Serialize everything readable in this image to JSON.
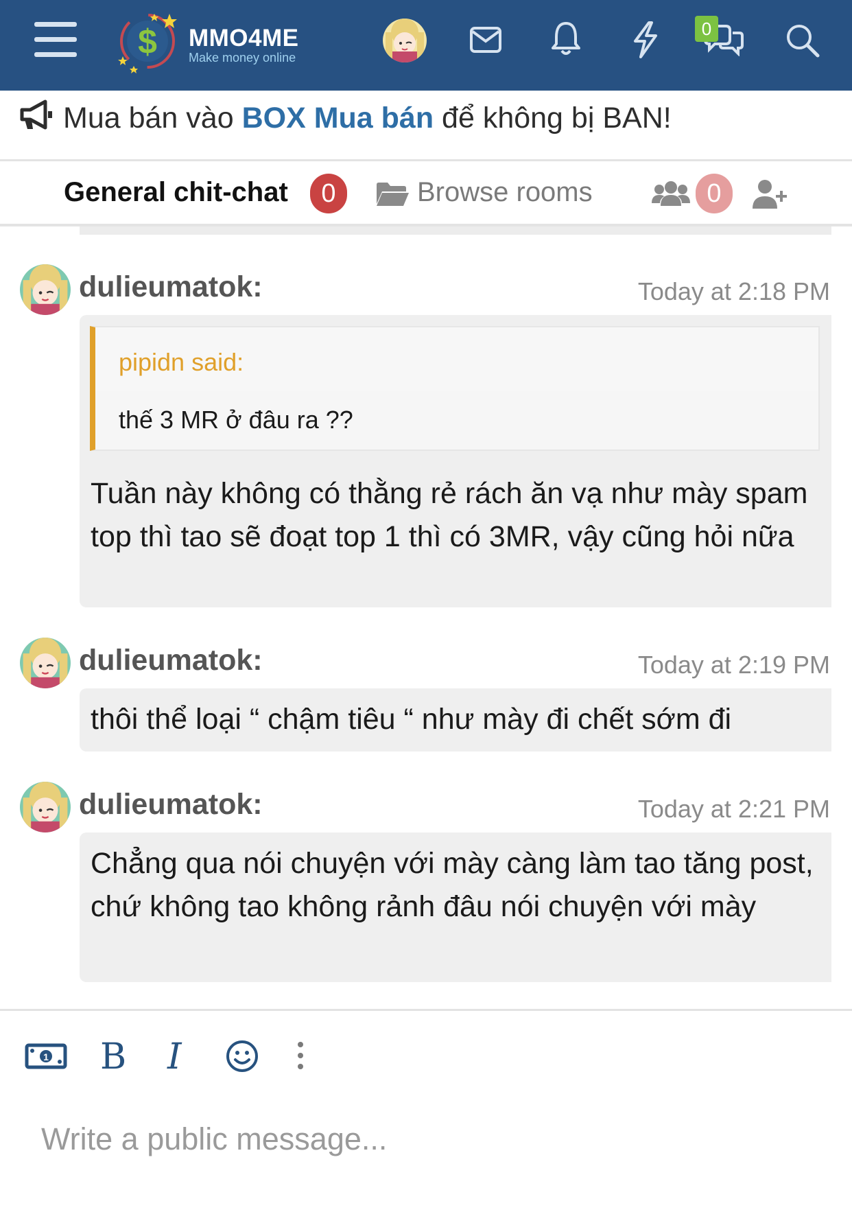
{
  "header": {
    "logo_name": "MMO4ME",
    "logo_tagline": "Make money online",
    "conversations_count": "0",
    "colors": {
      "bar": "#275182",
      "badge": "#7cc242"
    }
  },
  "notice": {
    "prefix": "Mua bán vào ",
    "link": "BOX Mua bán",
    "suffix": " để không bị BAN!"
  },
  "tabs": {
    "active_room": "General chit-chat",
    "active_room_count": "0",
    "browse_label": "Browse rooms",
    "members_count": "0"
  },
  "messages": [
    {
      "user": "dulieumatok:",
      "time": "Today at 2:18 PM",
      "quote_author": "pipidn said:",
      "quote_text": "thế 3 MR ở đâu ra ??",
      "text": "Tuần này không có thằng rẻ rách ăn vạ như mày spam top thì tao sẽ đoạt top 1 thì có 3MR, vậy cũng hỏi nữa"
    },
    {
      "user": "dulieumatok:",
      "time": "Today at 2:19 PM",
      "text": "thôi thể loại “ chậm tiêu “ như mày đi chết sớm đi"
    },
    {
      "user": "dulieumatok:",
      "time": "Today at 2:21 PM",
      "text": "Chẳng qua nói chuyện với mày càng làm tao tăng post, chứ không tao không rảnh đâu nói chuyện với mày"
    }
  ],
  "composer": {
    "placeholder": "Write a public message..."
  },
  "icons": [
    "menu-icon",
    "logo-icon",
    "avatar",
    "envelope-icon",
    "bell-icon",
    "bolt-icon",
    "chat-icon",
    "search-icon",
    "megaphone-icon",
    "folder-icon",
    "users-icon",
    "user-plus-icon",
    "money-icon",
    "bold-icon",
    "italic-icon",
    "smiley-icon",
    "more-icon"
  ]
}
